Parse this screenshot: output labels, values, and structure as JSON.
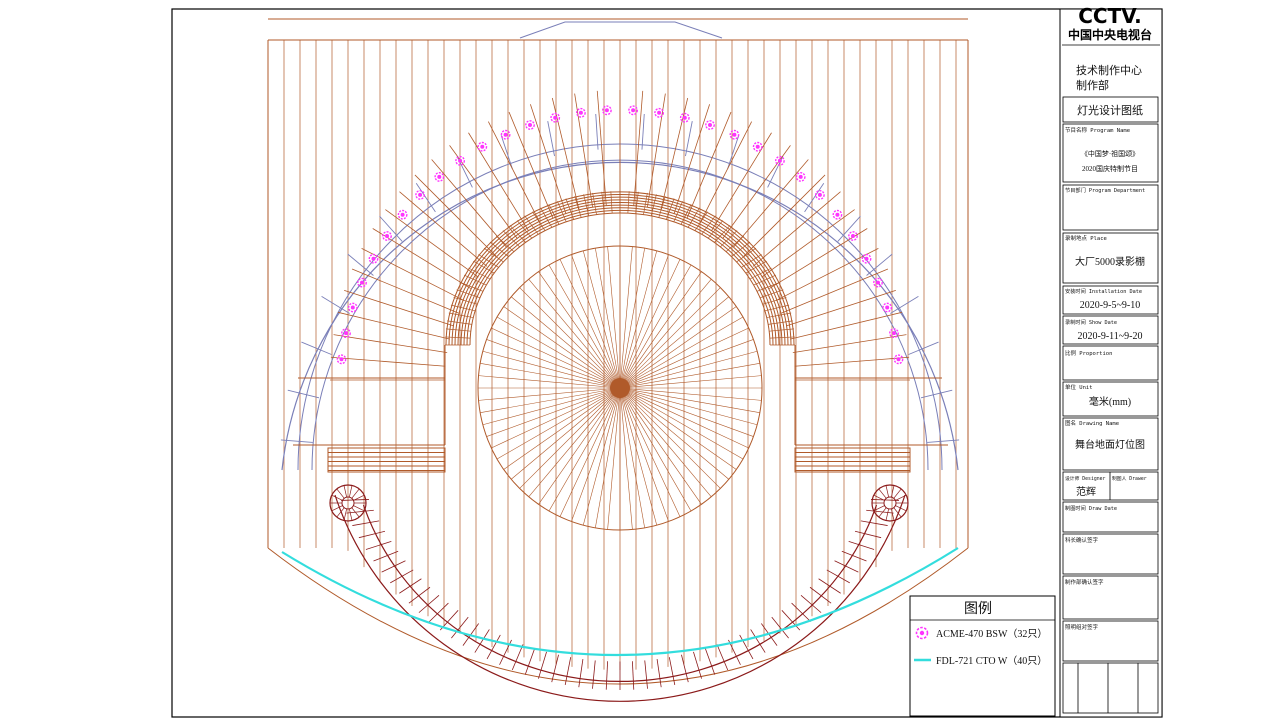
{
  "logo": {
    "brand": "CCTV.",
    "subtitle": "中国中央电视台"
  },
  "title_block": {
    "dept": [
      "技术制作中心",
      "制作部"
    ],
    "doc_title": "灯光设计图纸",
    "program_label": "节目名称 Program Name",
    "program_line1": "《中国梦·祖国颂》",
    "program_line2": "2020国庆特制节目",
    "department_label": "节目部门 Program Department",
    "place_label": "录制地点 Place",
    "place_value": "大厂5000录影棚",
    "install_label": "安装时间 Installation Date",
    "install_value": "2020-9-5~9-10",
    "show_label": "录制时间 Show Date",
    "show_value": "2020-9-11~9-20",
    "proportion_label": "比例 Proportion",
    "unit_label": "单位 Unit",
    "unit_value": "毫米(mm)",
    "drawing_label": "图名 Drawing Name",
    "drawing_value": "舞台地面灯位图",
    "designer_label": "设计师 Designer",
    "drawer_label": "制图人 Drawer",
    "designer_value": "范辉",
    "drawdate_label": "制图时间 Draw Date",
    "sign1_label": "科长确认签字",
    "sign2_label": "制作部确认签字",
    "sign3_label": "照明组对签字"
  },
  "legend": {
    "title": "图例",
    "items": [
      {
        "icon": "flower-fixture-icon",
        "color": "#ff33ff",
        "label": "ACME-470 BSW（32只）"
      },
      {
        "icon": "cyan-strip-line-icon",
        "color": "#33dddd",
        "label": "FDL-721 CTO W（40只）"
      }
    ]
  },
  "colors": {
    "stage_lines": "#b05a2a",
    "truss_blue": "#7a7fb8",
    "walkway": "#8b1a1a",
    "fixture": "#ff33ff",
    "strip": "#33dddd"
  }
}
